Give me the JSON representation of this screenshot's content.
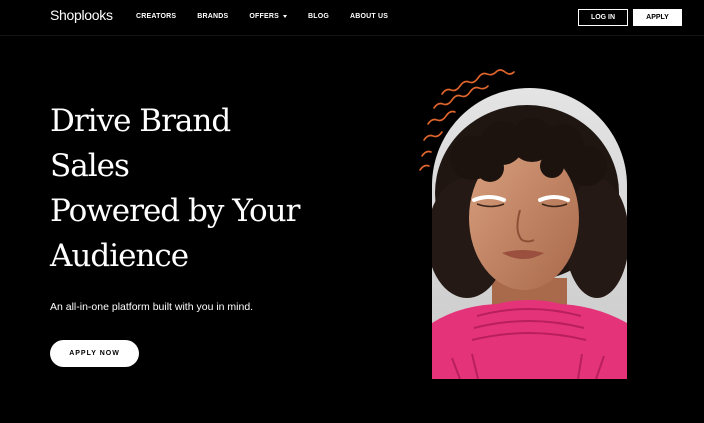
{
  "header": {
    "logo": "Shoplooks",
    "nav": [
      {
        "label": "CREATORS"
      },
      {
        "label": "BRANDS"
      },
      {
        "label": "OFFERS",
        "has_dropdown": true
      },
      {
        "label": "BLOG"
      },
      {
        "label": "ABOUT US"
      }
    ],
    "login_label": "LOG IN",
    "apply_label": "APPLY"
  },
  "hero": {
    "title_lines": [
      "Drive Brand",
      "Sales",
      "Powered by Your",
      "Audience"
    ],
    "subtitle": "An all-in-one platform built with you in mind.",
    "cta_label": "APPLY NOW"
  },
  "colors": {
    "background": "#000000",
    "text": "#ffffff",
    "accent_squiggle": "#e0652c",
    "portrait_backdrop": "#dcdcdc",
    "garment_pink": "#e5337a"
  },
  "icons": {
    "dropdown": "caret-down-icon",
    "decoration": "squiggle-wave-decoration"
  }
}
